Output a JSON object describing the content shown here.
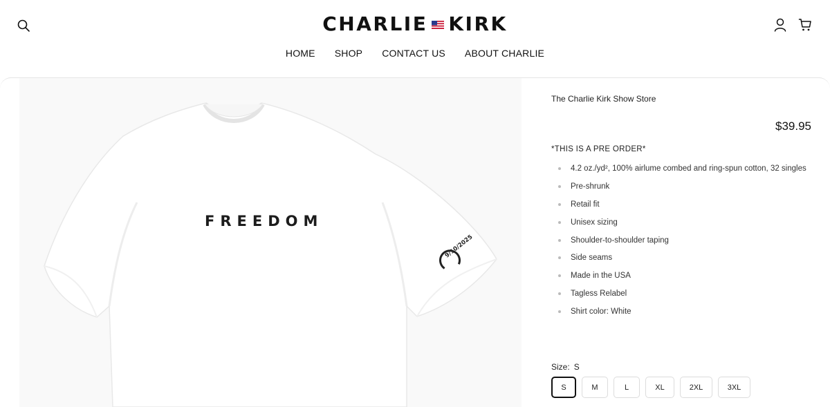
{
  "header": {
    "logo_left": "CHARLIE",
    "logo_right": "KIRK",
    "nav": [
      "HOME",
      "SHOP",
      "CONTACT US",
      "ABOUT CHARLIE"
    ]
  },
  "product": {
    "shirt_print": "FREEDOM",
    "sleeve_date": "9/10/2025",
    "vendor": "The Charlie Kirk Show Store",
    "price": "$39.95",
    "preorder_note": "*THIS IS A PRE ORDER*",
    "features": [
      "4.2 oz./yd², 100% airlume combed and ring-spun cotton, 32 singles",
      "Pre-shrunk",
      "Retail fit",
      "Unisex sizing",
      "Shoulder-to-shoulder taping",
      "Side seams",
      "Made in the USA",
      "Tagless Relabel",
      "Shirt color: White"
    ],
    "size_label": "Size:",
    "size_selected": "S",
    "sizes": [
      "S",
      "M",
      "L",
      "XL",
      "2XL",
      "3XL"
    ]
  },
  "colors": {
    "flag_red": "#c8102e",
    "flag_blue": "#2b3a8c",
    "text": "#111111"
  },
  "icons": [
    "search-icon",
    "account-icon",
    "cart-icon",
    "flag-icon"
  ]
}
